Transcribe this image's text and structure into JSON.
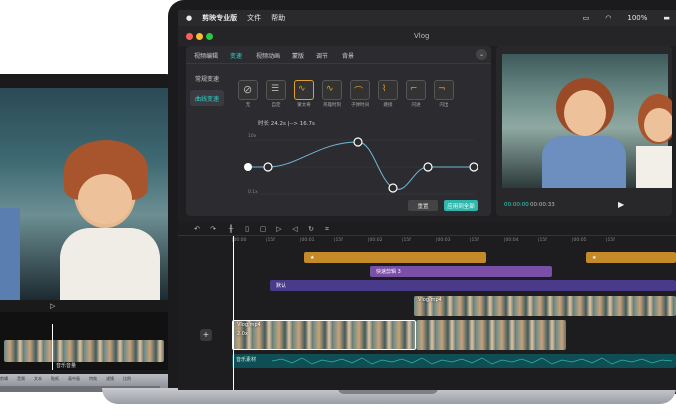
{
  "menubar": {
    "app_name": "剪映专业版",
    "menu_file": "文件",
    "menu_help": "帮助",
    "battery": "100%"
  },
  "window": {
    "title": "Vlog"
  },
  "panel": {
    "tabs": [
      "视频编辑",
      "变速",
      "视频动画",
      "蒙版",
      "调节",
      "背景"
    ],
    "active_tab": "变速",
    "side": [
      "常规变速",
      "曲线变速"
    ],
    "presets": [
      "无",
      "自定",
      "蒙太奇",
      "英雄时刻",
      "子弹时间",
      "跳接",
      "闪进",
      "闪出"
    ],
    "duration_text": "时长 24.2s |-->  16.7s",
    "y_top": "10x",
    "y_bottom": "0.1x",
    "reset_label": "重置",
    "apply_label": "应用到全部"
  },
  "preview": {
    "time_current": "00:00:00",
    "time_total": "00:00:33"
  },
  "timeline": {
    "ruler": [
      "|00:00",
      "|15f",
      "|00:01",
      "|15f",
      "|00:02",
      "|15f",
      "|00:03",
      "|15f",
      "|00:04",
      "|15f",
      "|00:05",
      "|15f"
    ],
    "clip_speed": "快速剪辑 3",
    "clip_text": "默认",
    "main_clip": "Vlog.mp4",
    "main_clip_speed": "2.0x",
    "upper_clip": "Vlog.mp4",
    "audio_label": "音乐素材"
  },
  "left_laptop": {
    "audio_label": "音乐音量",
    "tools": [
      "剪辑",
      "音频",
      "文本",
      "贴纸",
      "画中画",
      "特效",
      "滤镜",
      "比例",
      "背景",
      "调节"
    ]
  },
  "colors": {
    "accent": "#2fd3c6",
    "clip_gold": "#c48a2a",
    "clip_purple": "#7a4fa8",
    "clip_teal": "#136b73"
  }
}
